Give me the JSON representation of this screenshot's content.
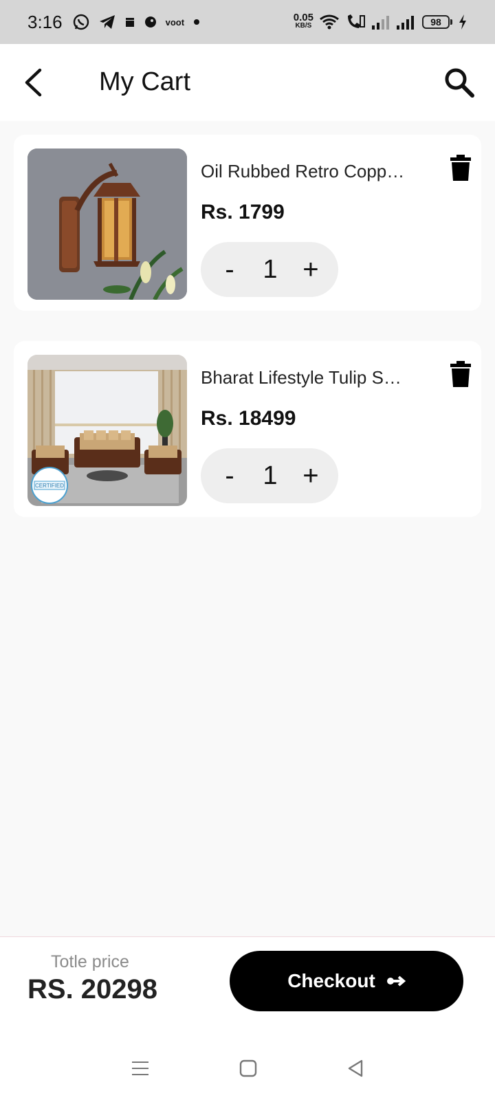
{
  "status_bar": {
    "time": "3:16",
    "net_speed_value": "0.05",
    "net_speed_unit": "KB/S",
    "battery_level": "98",
    "icons": [
      "whatsapp-icon",
      "telegram-icon",
      "clapper-icon",
      "ghost-icon",
      "voot-icon",
      "dot-icon",
      "wifi-icon",
      "call-icon",
      "signal-icon",
      "signal-icon",
      "charging-icon"
    ],
    "voot_text": "voot"
  },
  "header": {
    "title": "My Cart",
    "back_icon": "chevron-left-icon",
    "search_icon": "search-icon"
  },
  "cart": {
    "items": [
      {
        "name": "Oil Rubbed Retro Copper Wall Lamp",
        "price": "Rs. 1799",
        "quantity": "1",
        "minus_label": "-",
        "plus_label": "+",
        "image": "copper-wall-lantern-image"
      },
      {
        "name": "Bharat Lifestyle Tulip Sofa Set",
        "price": "Rs. 18499",
        "quantity": "1",
        "minus_label": "-",
        "plus_label": "+",
        "image": "living-room-sofa-set-image",
        "badge": "CERTIFIED"
      }
    ]
  },
  "footer": {
    "total_label": "Totle price",
    "total_value": "RS. 20298",
    "checkout_label": "Checkout",
    "checkout_icon": "arrow-right-icon"
  },
  "nav_bar": {
    "icons": [
      "menu-icon",
      "home-square-icon",
      "back-triangle-icon"
    ]
  },
  "colors": {
    "background": "#f9f9f9",
    "card": "#ffffff",
    "accent": "#000000",
    "stepper": "#eeeeee",
    "muted_text": "#8a8a8a"
  }
}
